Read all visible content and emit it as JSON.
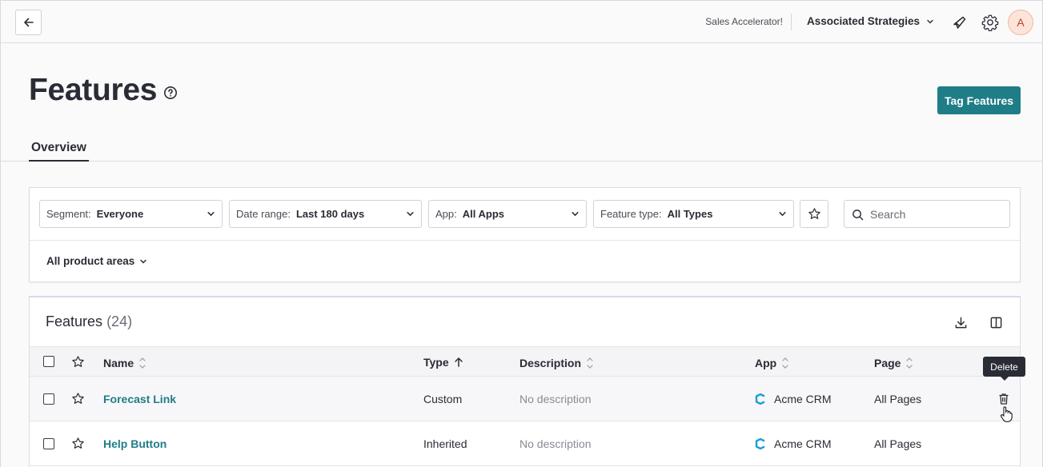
{
  "topbar": {
    "subscription": "Sales Accelerator!",
    "app_switcher": "Associated Strategies",
    "avatar_initial": "A"
  },
  "page": {
    "title": "Features",
    "tag_button": "Tag Features",
    "tabs": [
      {
        "label": "Overview"
      }
    ]
  },
  "filters": {
    "segment": {
      "label": "Segment:",
      "value": "Everyone"
    },
    "date_range": {
      "label": "Date range:",
      "value": "Last 180 days"
    },
    "app": {
      "label": "App:",
      "value": "All Apps"
    },
    "feature_type": {
      "label": "Feature type:",
      "value": "All Types"
    },
    "search_placeholder": "Search",
    "product_areas": "All product areas"
  },
  "table": {
    "title": "Features",
    "count": "(24)",
    "columns": {
      "name": "Name",
      "type": "Type",
      "description": "Description",
      "app": "App",
      "page": "Page"
    },
    "rows": [
      {
        "name": "Forecast Link",
        "type": "Custom",
        "description": "No description",
        "app": "Acme CRM",
        "page": "All Pages"
      },
      {
        "name": "Help Button",
        "type": "Inherited",
        "description": "No description",
        "app": "Acme CRM",
        "page": "All Pages"
      }
    ],
    "tooltip": "Delete"
  },
  "colors": {
    "accent": "#1f7d87",
    "text": "#2a2c35",
    "muted": "#8a8c95",
    "app_logo": "#1a9fd9"
  }
}
